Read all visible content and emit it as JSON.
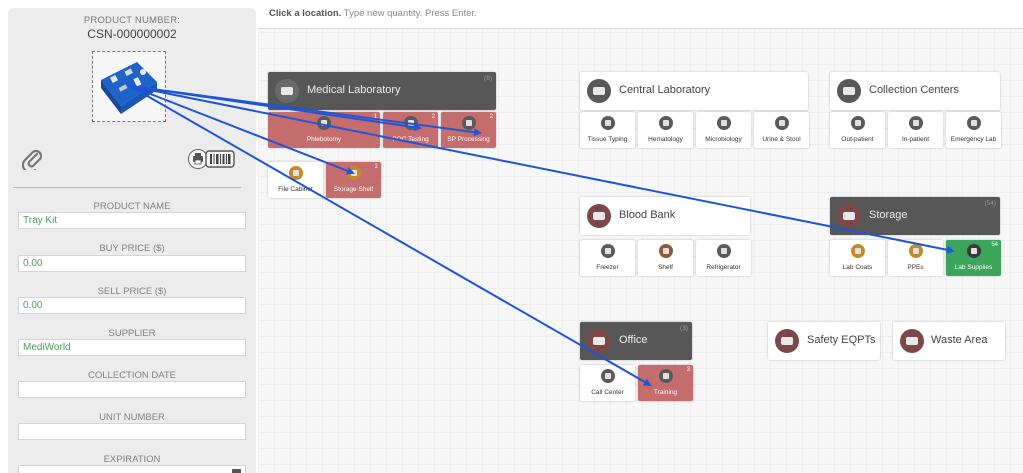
{
  "product": {
    "number_label": "PRODUCT NUMBER:",
    "number_value": "CSN-000000002"
  },
  "fields": [
    {
      "label": "PRODUCT NAME",
      "value": "Tray Kit"
    },
    {
      "label": "BUY PRICE ($)",
      "value": "0.00"
    },
    {
      "label": "SELL PRICE ($)",
      "value": "0.00"
    },
    {
      "label": "SUPPLIER",
      "value": "MediWorld"
    },
    {
      "label": "COLLECTION DATE",
      "value": ""
    },
    {
      "label": "UNIT NUMBER",
      "value": ""
    },
    {
      "label": "EXPIRATION",
      "value": ""
    }
  ],
  "instruction": {
    "bold": "Click a location.",
    "rest": " Type new quantity. Press Enter."
  },
  "locations": {
    "medical_lab": {
      "name": "Medical Laboratory",
      "count": "(8)"
    },
    "central_lab": {
      "name": "Central Laboratory"
    },
    "collection_centers": {
      "name": "Collection Centers"
    },
    "blood_bank": {
      "name": "Blood Bank"
    },
    "storage": {
      "name": "Storage",
      "count": "(54)"
    },
    "office": {
      "name": "Office",
      "count": "(3)"
    },
    "safety": {
      "name": "Safety EQPTs"
    },
    "waste": {
      "name": "Waste Area"
    }
  },
  "sublocations": {
    "phlebotomy": {
      "name": "Phlebotomy",
      "count": "1"
    },
    "poc_testing": {
      "name": "POC Testing",
      "count": "2"
    },
    "sp_processing": {
      "name": "SP Processing",
      "count": "2"
    },
    "file_cabinet": {
      "name": "File Cabinet"
    },
    "storage_shelf": {
      "name": "Storage Shelf",
      "count": "2"
    },
    "tissue_typing": {
      "name": "Tissue Typing"
    },
    "hematology": {
      "name": "Hematology"
    },
    "microbiology": {
      "name": "Microbiology"
    },
    "urine_stool": {
      "name": "Urine & Stool"
    },
    "out_patient": {
      "name": "Out-patient"
    },
    "in_patient": {
      "name": "In-patient"
    },
    "emergency_lab": {
      "name": "Emergency Lab"
    },
    "freezer": {
      "name": "Freezer"
    },
    "shelf": {
      "name": "Shelf"
    },
    "refrigerator": {
      "name": "Refrigerator"
    },
    "lab_coats": {
      "name": "Lab Coats"
    },
    "ppes": {
      "name": "PPEs"
    },
    "lab_supplies": {
      "name": "Lab Supplies",
      "count": "54"
    },
    "call_center": {
      "name": "Call Center"
    },
    "training": {
      "name": "Training",
      "count": "3"
    }
  },
  "colors": {
    "stocked": "#c56c6c",
    "selected": "#3ba55c",
    "arrow": "#1f55d6",
    "field_text": "#4e9c55"
  }
}
